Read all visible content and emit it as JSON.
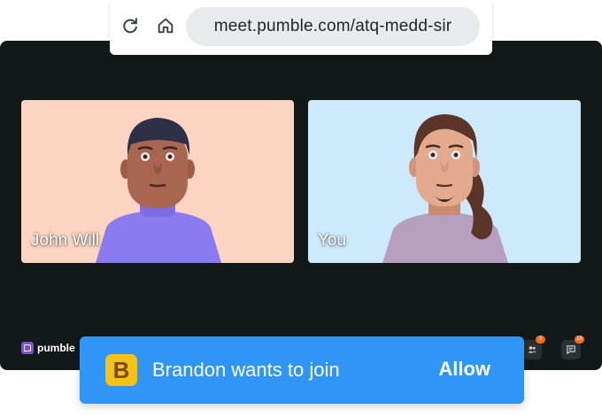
{
  "browser": {
    "url": "meet.pumble.com/atq-medd-sir",
    "icons": [
      "reload-icon",
      "home-icon"
    ]
  },
  "participants": [
    {
      "name": "John Will",
      "tile_color": "#fcd5c2"
    },
    {
      "name": "You",
      "tile_color": "#cdeafc"
    }
  ],
  "brand": {
    "name": "pumble",
    "color": "#7b4fd6"
  },
  "controls": {
    "participants_badge": "3",
    "chat_badge": "16"
  },
  "join_request": {
    "avatar_letter": "B",
    "message": "Brandon wants to join",
    "allow_label": "Allow",
    "color": "#2f95f6"
  },
  "colors": {
    "background": "#131819",
    "accent_badge": "#f26b21"
  }
}
